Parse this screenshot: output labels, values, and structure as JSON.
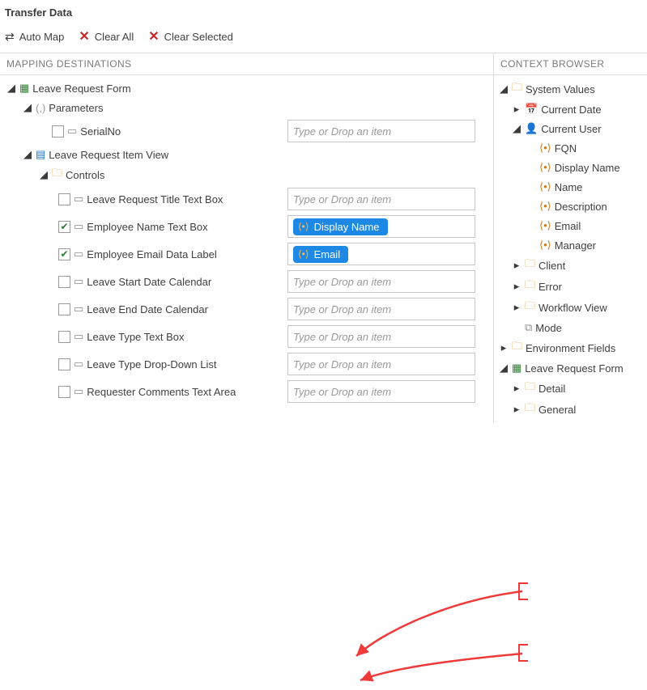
{
  "title": "Transfer Data",
  "toolbar": {
    "automap": "Auto Map",
    "clear_all": "Clear All",
    "clear_selected": "Clear Selected"
  },
  "left": {
    "heading": "MAPPING DESTINATIONS",
    "form_label": "Leave Request Form",
    "parameters_label": "Parameters",
    "serial_no": "SerialNo",
    "view_label": "Leave Request Item View",
    "controls_label": "Controls",
    "placeholder": "Type or Drop an item",
    "rows": {
      "title_tb": "Leave Request Title Text Box",
      "emp_name_tb": "Employee Name Text Box",
      "emp_email_dl": "Employee Email Data Label",
      "start_cal": "Leave Start Date Calendar",
      "end_cal": "Leave End Date Calendar",
      "type_tb": "Leave Type Text Box",
      "type_dd": "Leave Type Drop-Down List",
      "req_comments": "Requester Comments Text Area"
    },
    "chips": {
      "display_name": "Display Name",
      "email": "Email"
    }
  },
  "right": {
    "heading": "CONTEXT BROWSER",
    "system_values": "System Values",
    "current_date": "Current Date",
    "current_user": "Current User",
    "fqn": "FQN",
    "display_name": "Display Name",
    "name": "Name",
    "description": "Description",
    "email": "Email",
    "manager": "Manager",
    "client": "Client",
    "error": "Error",
    "workflow_view": "Workflow View",
    "mode": "Mode",
    "environment_fields": "Environment Fields",
    "leave_request_form": "Leave Request Form",
    "detail": "Detail",
    "general": "General"
  }
}
